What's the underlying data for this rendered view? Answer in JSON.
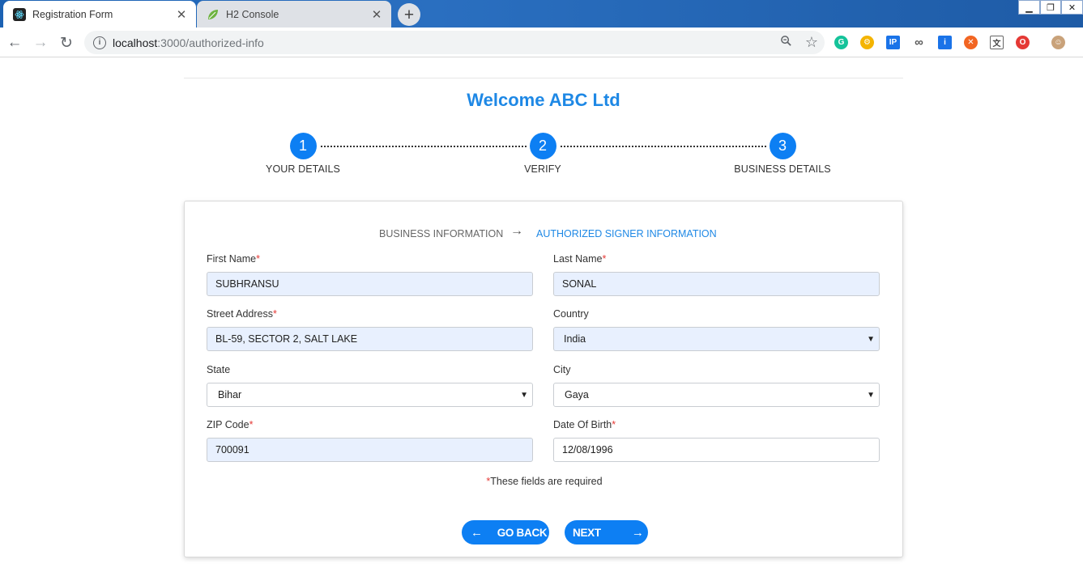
{
  "browser": {
    "tabs": [
      {
        "title": "Registration Form",
        "close": "✕"
      },
      {
        "title": "H2 Console",
        "close": "✕"
      }
    ],
    "new_tab": "+",
    "window_controls": {
      "minimize": "▁",
      "restore": "❐",
      "close": "✕"
    },
    "nav": {
      "back": "←",
      "forward": "→",
      "reload": "↻"
    },
    "url_host": "localhost",
    "url_path": ":3000/authorized-info",
    "omnibox_icons": {
      "zoom": "🔍",
      "star": "☆"
    }
  },
  "page": {
    "welcome": "Welcome ABC Ltd",
    "steps": [
      {
        "number": "1",
        "label": "YOUR DETAILS"
      },
      {
        "number": "2",
        "label": "VERIFY"
      },
      {
        "number": "3",
        "label": "BUSINESS DETAILS"
      }
    ],
    "subnav": {
      "business": "BUSINESS INFORMATION",
      "arrow": "→",
      "authorized": "AUTHORIZED SIGNER INFORMATION"
    },
    "fields": {
      "first_name": {
        "label": "First Name",
        "required": "*",
        "value": "SUBHRANSU"
      },
      "last_name": {
        "label": "Last Name",
        "required": "*",
        "value": "SONAL"
      },
      "street": {
        "label": "Street Address",
        "required": "*",
        "value": "BL-59, SECTOR 2, SALT LAKE"
      },
      "country": {
        "label": "Country",
        "value": "India"
      },
      "state": {
        "label": "State",
        "value": "Bihar"
      },
      "city": {
        "label": "City",
        "value": "Gaya"
      },
      "zip": {
        "label": "ZIP Code",
        "required": "*",
        "value": "700091"
      },
      "dob": {
        "label": "Date Of Birth",
        "required": "*",
        "value": "12/08/1996"
      }
    },
    "select_caret": "▼",
    "required_note": {
      "star": "*",
      "text": "These fields are required"
    },
    "buttons": {
      "back": {
        "label": "GO BACK",
        "icon": "←"
      },
      "next": {
        "label": "NEXT",
        "icon": "→"
      }
    }
  }
}
